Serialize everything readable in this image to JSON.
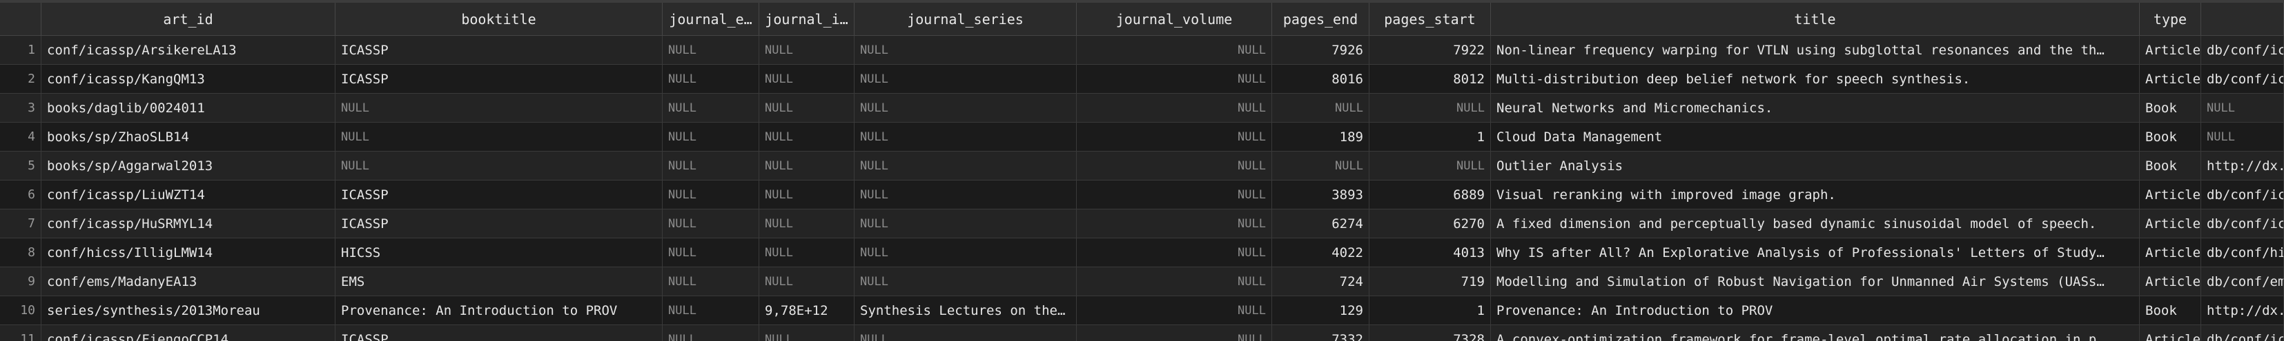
{
  "columns": [
    "",
    "art_id",
    "booktitle",
    "journal_e…",
    "journal_i…",
    "journal_series",
    "journal_volume",
    "pages_end",
    "pages_start",
    "title",
    "type",
    ""
  ],
  "rows": [
    [
      "1",
      "conf/icassp/ArsikereLA13",
      "ICASSP",
      "NULL",
      "NULL",
      "NULL",
      "NULL",
      "7926",
      "7922",
      "Non-linear frequency warping for VTLN using subglottal resonances and the th…",
      "Article",
      "db/conf/icassp/"
    ],
    [
      "2",
      "conf/icassp/KangQM13",
      "ICASSP",
      "NULL",
      "NULL",
      "NULL",
      "NULL",
      "8016",
      "8012",
      "Multi-distribution deep belief network for speech synthesis.",
      "Article",
      "db/conf/icassp/"
    ],
    [
      "3",
      "books/daglib/0024011",
      "NULL",
      "NULL",
      "NULL",
      "NULL",
      "NULL",
      "NULL",
      "NULL",
      "Neural Networks and Micromechanics.",
      "Book",
      "NULL"
    ],
    [
      "4",
      "books/sp/ZhaoSLB14",
      "NULL",
      "NULL",
      "NULL",
      "NULL",
      "NULL",
      "189",
      "1",
      "Cloud Data Management",
      "Book",
      "NULL"
    ],
    [
      "5",
      "books/sp/Aggarwal2013",
      "NULL",
      "NULL",
      "NULL",
      "NULL",
      "NULL",
      "NULL",
      "NULL",
      "Outlier Analysis",
      "Book",
      "http://dx.doi.o"
    ],
    [
      "6",
      "conf/icassp/LiuWZT14",
      "ICASSP",
      "NULL",
      "NULL",
      "NULL",
      "NULL",
      "3893",
      "6889",
      "Visual reranking with improved image graph.",
      "Article",
      "db/conf/icassp/"
    ],
    [
      "7",
      "conf/icassp/HuSRMYL14",
      "ICASSP",
      "NULL",
      "NULL",
      "NULL",
      "NULL",
      "6274",
      "6270",
      "A fixed dimension and perceptually based dynamic sinusoidal model of speech.",
      "Article",
      "db/conf/icassp/"
    ],
    [
      "8",
      "conf/hicss/IlligLMW14",
      "HICSS",
      "NULL",
      "NULL",
      "NULL",
      "NULL",
      "4022",
      "4013",
      "Why IS after All? An Explorative Analysis of Professionals' Letters of Study…",
      "Article",
      "db/conf/hicss/h"
    ],
    [
      "9",
      "conf/ems/MadanyEA13",
      "EMS",
      "NULL",
      "NULL",
      "NULL",
      "NULL",
      "724",
      "719",
      "Modelling and Simulation of Robust Navigation for Unmanned Air Systems (UASs…",
      "Article",
      "db/conf/ems/ems"
    ],
    [
      "10",
      "series/synthesis/2013Moreau",
      "Provenance: An Introduction to PROV",
      "NULL",
      "9,78E+12",
      "Synthesis Lectures on the…",
      "NULL",
      "129",
      "1",
      "Provenance: An Introduction to PROV",
      "Book",
      "http://dx.doi.o"
    ],
    [
      "11",
      "conf/icassp/FiengoCCP14",
      "ICASSP",
      "NULL",
      "NULL",
      "NULL",
      "NULL",
      "7332",
      "7328",
      "A convex-optimization framework for frame-level optimal rate allocation in p…",
      "Article",
      "db/conf/icassp/"
    ]
  ]
}
